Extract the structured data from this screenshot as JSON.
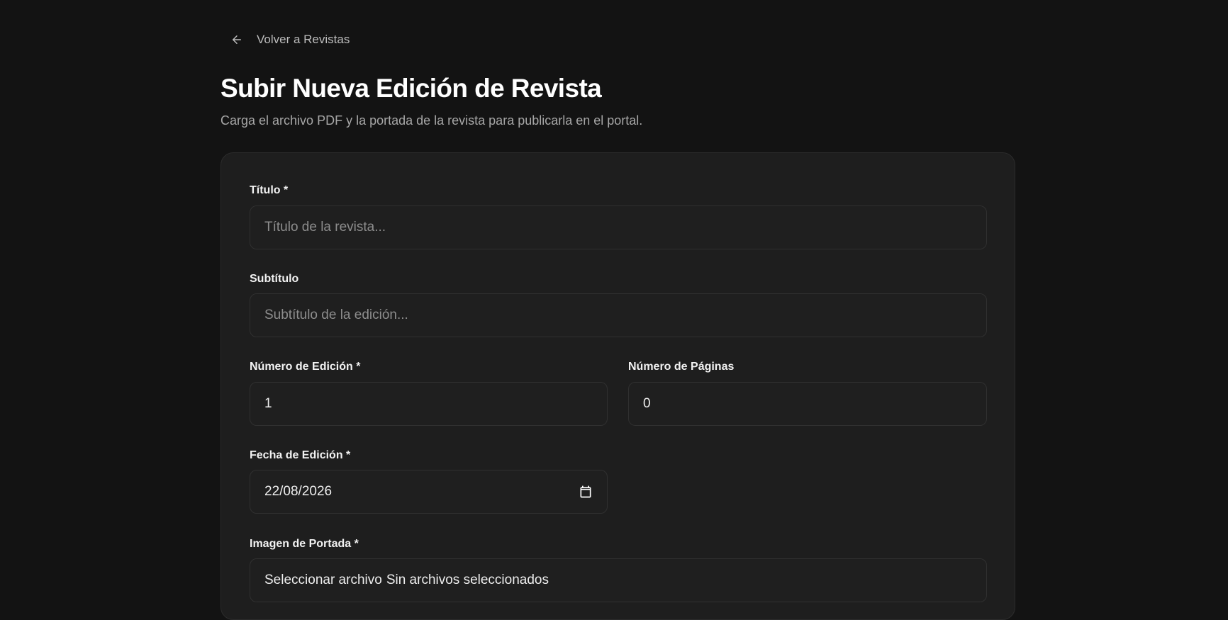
{
  "nav": {
    "back_label": "Volver a Revistas"
  },
  "header": {
    "title": "Subir Nueva Edición de Revista",
    "subtitle": "Carga el archivo PDF y la portada de la revista para publicarla en el portal."
  },
  "form": {
    "titulo": {
      "label": "Título *",
      "placeholder": "Título de la revista..."
    },
    "subtitulo": {
      "label": "Subtítulo",
      "placeholder": "Subtítulo de la edición..."
    },
    "numero_edicion": {
      "label": "Número de Edición *",
      "value": "1"
    },
    "numero_paginas": {
      "label": "Número de Páginas",
      "value": "0"
    },
    "fecha_edicion": {
      "label": "Fecha de Edición *",
      "value": "22/08/2026",
      "icon": "calendar-icon"
    },
    "imagen_portada": {
      "label": "Imagen de Portada *",
      "button_label": "Seleccionar archivo",
      "status": "Sin archivos seleccionados"
    }
  },
  "colors": {
    "background": "#131313",
    "card": "#1e1e1e",
    "input_border": "#303030",
    "muted_text": "#a7a7a7"
  }
}
